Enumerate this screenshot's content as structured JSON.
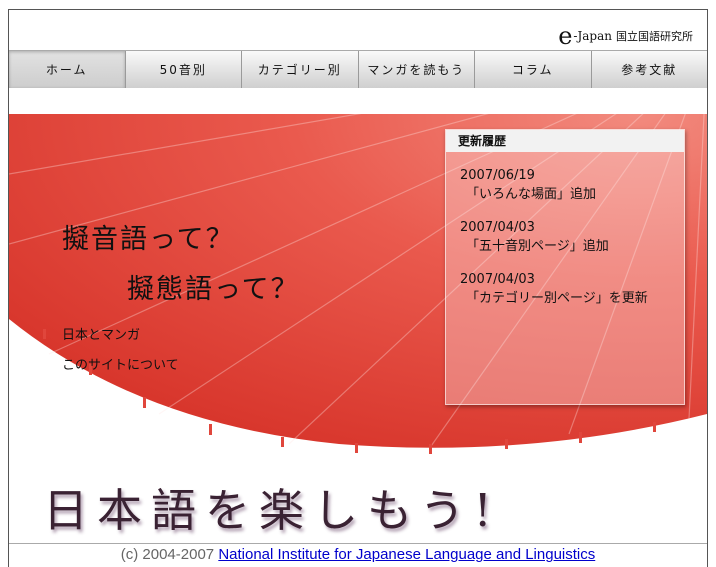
{
  "header": {
    "logo_e": "e",
    "logo_japan": "-Japan",
    "logo_institute": "国立国語研究所"
  },
  "nav": {
    "items": [
      {
        "label": "ホーム"
      },
      {
        "label": "50音別"
      },
      {
        "label": "カテゴリー別"
      },
      {
        "label": "マンガを読もう"
      },
      {
        "label": "コラム"
      },
      {
        "label": "参考文献"
      }
    ]
  },
  "hero": {
    "question1": "擬音語って？",
    "question2": "擬態語って？",
    "links": [
      {
        "label": "日本とマンガ"
      },
      {
        "label": "このサイトについて"
      }
    ],
    "slogan": "日本語を楽しもう!"
  },
  "news": {
    "title": "更新履歴",
    "entries": [
      {
        "date": "2007/06/19",
        "text": "「いろんな場面」追加"
      },
      {
        "date": "2007/04/03",
        "text": "「五十音別ページ」追加"
      },
      {
        "date": "2007/04/03",
        "text": "「カテゴリー別ページ」を更新"
      }
    ]
  },
  "footer": {
    "copyright": "(c) 2004-2007",
    "link": "National Institute for Japanese Language and Linguistics"
  },
  "colors": {
    "umbrella": "#e8453c",
    "slogan": "#3a2233",
    "footer_link": "#0000cc"
  }
}
